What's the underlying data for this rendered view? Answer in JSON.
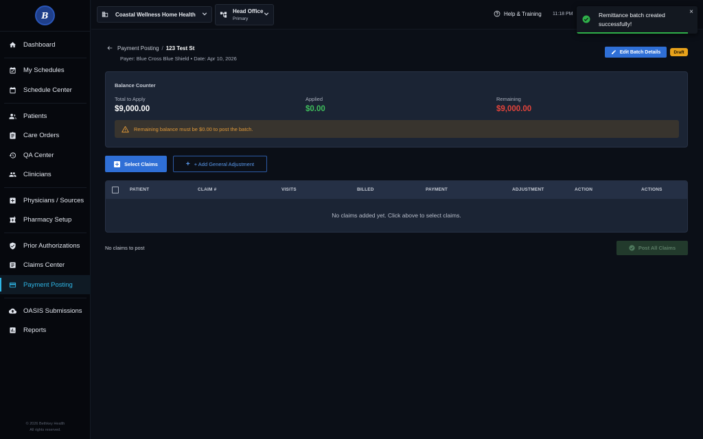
{
  "sidebar": {
    "logo_text": "B",
    "items": [
      {
        "label": "Dashboard",
        "icon": "home-icon"
      },
      {
        "label": "My Schedules",
        "icon": "calendar-check-icon"
      },
      {
        "label": "Schedule Center",
        "icon": "calendar-icon"
      },
      {
        "label": "Patients",
        "icon": "people-icon"
      },
      {
        "label": "Care Orders",
        "icon": "clipboard-icon"
      },
      {
        "label": "QA Center",
        "icon": "history-icon"
      },
      {
        "label": "Clinicians",
        "icon": "group-icon"
      },
      {
        "label": "Physicians / Sources",
        "icon": "medical-plus-icon"
      },
      {
        "label": "Pharmacy Setup",
        "icon": "pharmacy-icon"
      },
      {
        "label": "Prior Authorizations",
        "icon": "shield-check-icon"
      },
      {
        "label": "Claims Center",
        "icon": "document-icon"
      },
      {
        "label": "Payment Posting",
        "icon": "credit-card-icon"
      },
      {
        "label": "OASIS Submissions",
        "icon": "cloud-upload-icon"
      },
      {
        "label": "Reports",
        "icon": "bar-chart-icon"
      }
    ],
    "footer_line1": "© 2026 Bethkey Health",
    "footer_line2": "All rights reserved."
  },
  "topbar": {
    "org_name": "Coastal Wellness Home Health",
    "office_name": "Head Office",
    "office_sub": "Primary",
    "help_label": "Help & Training",
    "time": "11:18 PM"
  },
  "toast": {
    "message": "Remittance batch created successfully!",
    "close": "×",
    "color": "#2fb04a"
  },
  "page": {
    "breadcrumb_parent": "Payment Posting",
    "breadcrumb_sep": "/",
    "breadcrumb_current": "123 Test St",
    "subline": "Payer: Blue Cross Blue Shield • Date: Apr 10, 2026",
    "edit_label": "Edit Batch Details",
    "status": "Draft"
  },
  "balance": {
    "title": "Balance Counter",
    "total_label": "Total to Apply",
    "total_value": "$9,000.00",
    "applied_label": "Applied",
    "applied_value": "$0.00",
    "remaining_label": "Remaining",
    "remaining_value": "$9,000.00",
    "warning": "Remaining balance must be $0.00 to post the batch.",
    "colors": {
      "applied": "#3fbf5c",
      "remaining": "#e5443b",
      "warning": "#e19a3a"
    }
  },
  "actions": {
    "select_claims": "Select Claims",
    "add_adjustment": "+ Add General Adjustment"
  },
  "table": {
    "columns": [
      "PATIENT",
      "CLAIM #",
      "VISITS",
      "BILLED",
      "PAYMENT",
      "ADJUSTMENT",
      "ACTION",
      "ACTIONS"
    ],
    "empty_message": "No claims added yet. Click above to select claims."
  },
  "footer": {
    "status": "No claims to post",
    "post_label": "Post All Claims"
  }
}
